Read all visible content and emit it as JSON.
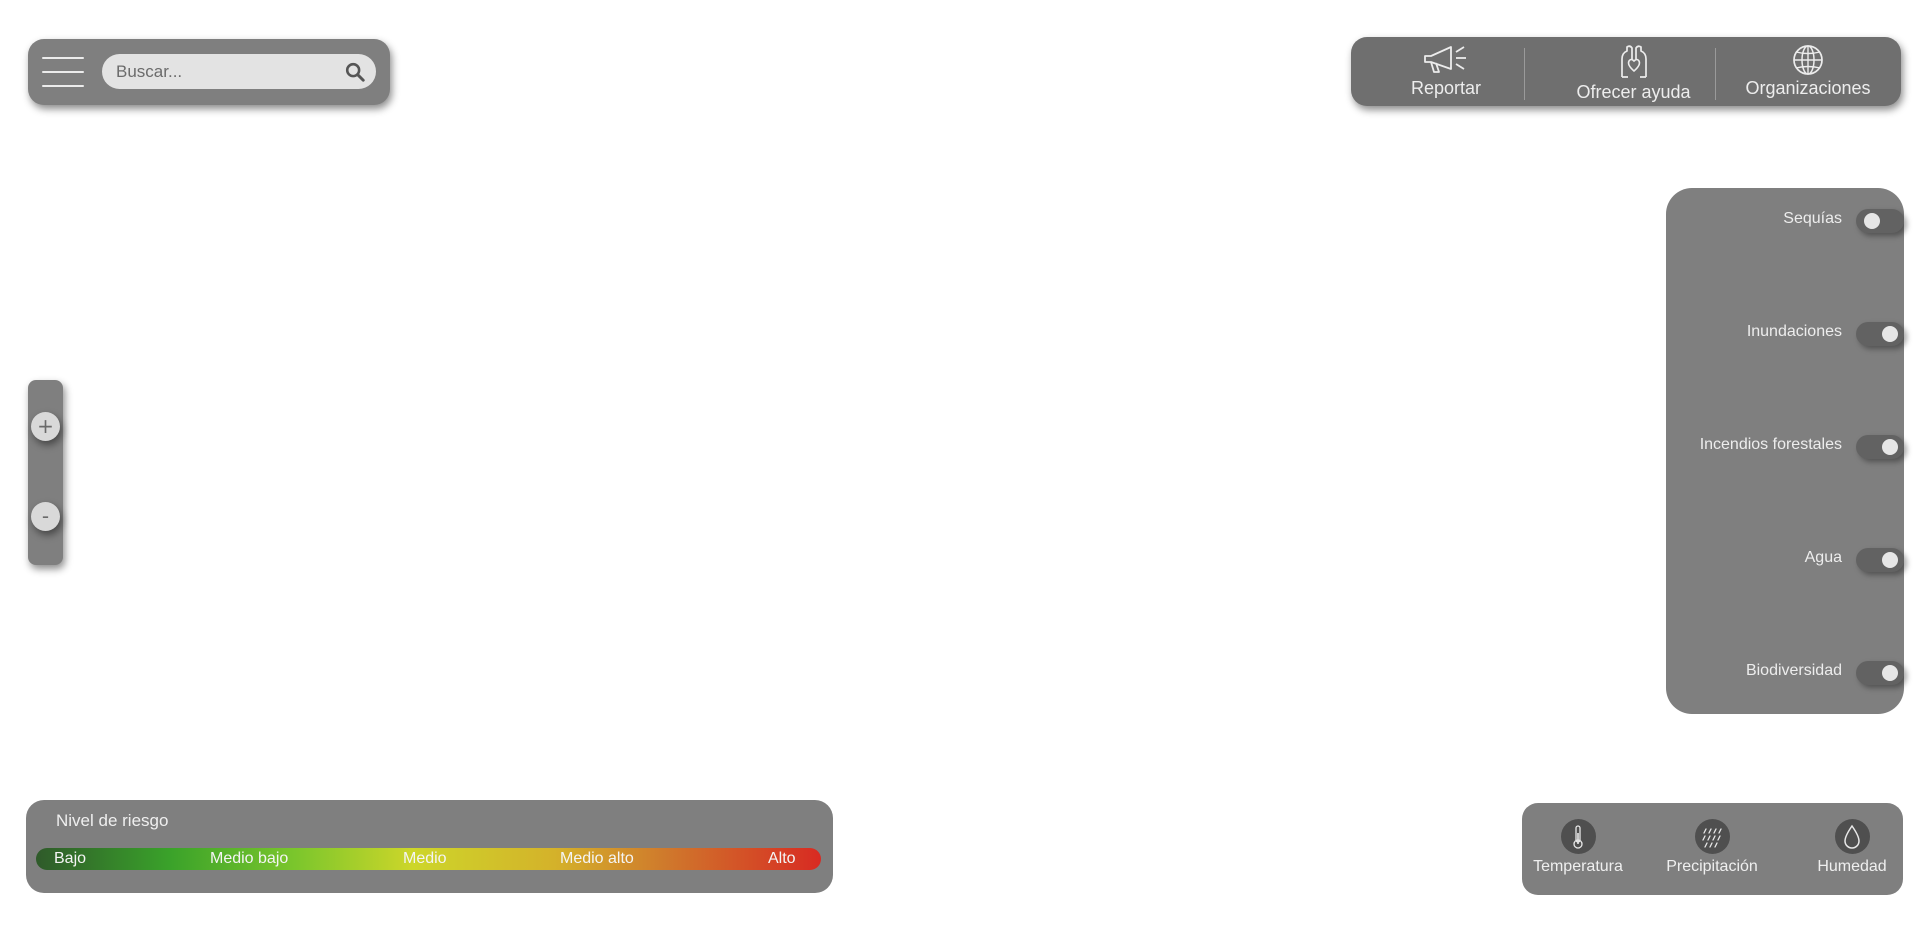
{
  "search": {
    "placeholder": "Buscar..."
  },
  "actions": [
    {
      "label": "Reportar",
      "icon": "megaphone-icon"
    },
    {
      "label": "Ofrecer ayuda",
      "icon": "helping-hands-icon"
    },
    {
      "label": "Organizaciones",
      "icon": "globe-icon"
    }
  ],
  "zoom": {
    "in_label": "+",
    "out_label": "-"
  },
  "layers": [
    {
      "label": "Sequías",
      "enabled": false
    },
    {
      "label": "Inundaciones",
      "enabled": true
    },
    {
      "label": "Incendios forestales",
      "enabled": true
    },
    {
      "label": "Agua",
      "enabled": true
    },
    {
      "label": "Biodiversidad",
      "enabled": true
    }
  ],
  "risk": {
    "title": "Nivel de riesgo",
    "levels": [
      "Bajo",
      "Medio bajo",
      "Medio",
      "Medio alto",
      "Alto"
    ],
    "colors": [
      "#2f5a2a",
      "#3aa22a",
      "#cdd62a",
      "#cf7a2c",
      "#d82a22"
    ]
  },
  "weather": [
    {
      "label": "Temperatura",
      "icon": "thermometer-icon"
    },
    {
      "label": "Precipitación",
      "icon": "rain-icon"
    },
    {
      "label": "Humedad",
      "icon": "droplet-icon"
    }
  ],
  "colors": {
    "panel": "#7f7f7f",
    "panel_dark": "#6f6f6f",
    "toggle_track": "#626262"
  }
}
